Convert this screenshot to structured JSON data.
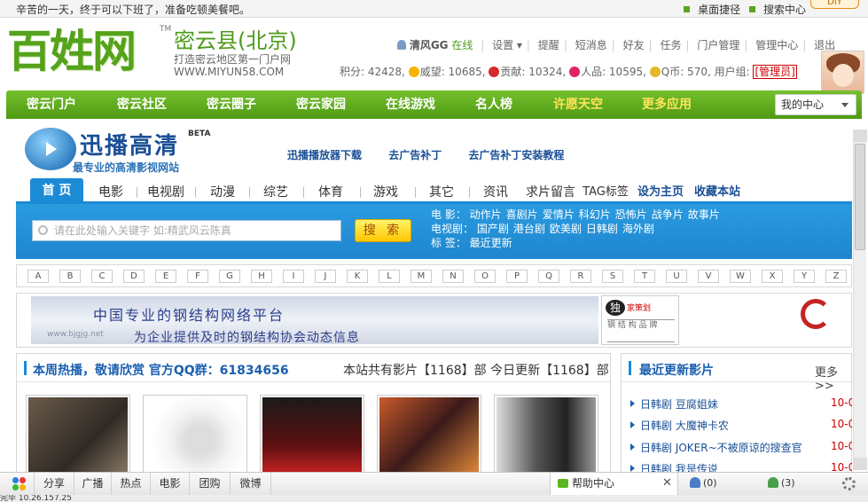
{
  "topbar": {
    "greeting": "辛苦的一天，终于可以下班了，准备吃顿美餐吧。",
    "links": [
      "桌面捷径",
      "搜索中心"
    ],
    "diy": "DIY"
  },
  "header": {
    "logo_text": "百姓网",
    "logo_tm": "TM",
    "site_name": "密云县(北京)",
    "slogan": "打造密云地区第一门户网",
    "url": "WWW.MIYUN58.COM",
    "user": "清风GG",
    "online": "在线",
    "menu": [
      "设置 ▾",
      "提醒",
      "短消息",
      "好友",
      "任务",
      "门户管理",
      "管理中心",
      "退出"
    ],
    "stats": {
      "points": "积分: 42428",
      "prestige": "威望: 10685",
      "contribution": "贡献: 10324",
      "popularity": "人品: 10595",
      "qb": "Q币: 570",
      "group_label": "用户组:",
      "group": "[管理员]"
    }
  },
  "nav": {
    "items": [
      "密云门户",
      "密云社区",
      "密云圈子",
      "密云家园",
      "在线游戏",
      "名人榜",
      "许愿天空",
      "更多应用"
    ],
    "my_center": "我的中心"
  },
  "xunbo": {
    "title": "迅播高清",
    "beta": "BETA",
    "subtitle": "最专业的高清影视网站",
    "links": [
      "迅播播放器下载",
      "去广告补丁",
      "去广告补丁安装教程"
    ],
    "tabs": [
      "首 页",
      "电影",
      "电视剧",
      "动漫",
      "综艺",
      "体育",
      "游戏",
      "其它",
      "资讯",
      "求片留言",
      "TAG标签",
      "设为主页",
      "收藏本站"
    ],
    "search_placeholder": "请在此处输入关键字 如:精武风云陈真",
    "search_button": "搜 索",
    "cats": {
      "movie_label": "电  影：",
      "movie": [
        "动作片",
        "喜剧片",
        "爱情片",
        "科幻片",
        "恐怖片",
        "战争片",
        "故事片"
      ],
      "tv_label": "电视剧：",
      "tv": [
        "国产剧",
        "港台剧",
        "欧美剧",
        "日韩剧",
        "海外剧"
      ],
      "tag_label": "标  签：",
      "tag": [
        "最近更新"
      ]
    },
    "letters": [
      "A",
      "B",
      "C",
      "D",
      "E",
      "F",
      "G",
      "H",
      "I",
      "J",
      "K",
      "L",
      "M",
      "N",
      "O",
      "P",
      "Q",
      "R",
      "S",
      "T",
      "U",
      "V",
      "W",
      "X",
      "Y",
      "Z"
    ],
    "banner": {
      "line1": "中国专业的钢结构网络平台",
      "line2": "为企业提供及时的钢结构协会动态信息",
      "watermark": "www.bjgjg.net",
      "ad2_badge": "独",
      "ad2_text": "家策划",
      "ad2_grid": "钢 结 构 品 牌"
    },
    "hot": {
      "title": "本周热播，敬请欣赏 官方QQ群：61834656",
      "count": "本站共有影片【1168】部 今日更新【1168】部"
    },
    "latest": {
      "title": "最近更新影片",
      "more": "更多>>",
      "items": [
        {
          "text": "日韩剧  豆腐姐妹",
          "date": "10-0"
        },
        {
          "text": "日韩剧  大魔神卡农",
          "date": "10-0"
        },
        {
          "text": "日韩剧  JOKER~不被原谅的搜查官",
          "date": "10-0"
        },
        {
          "text": "日韩剧  我是传说",
          "date": "10-0"
        }
      ]
    }
  },
  "bottombar": {
    "buttons": [
      "分享",
      "广播",
      "热点",
      "电影",
      "团购",
      "微博"
    ],
    "help": "帮助中心",
    "close": "✕",
    "online_count": "(0)",
    "friend_count": "(3)"
  },
  "status": "完毕  10.26.157.25"
}
